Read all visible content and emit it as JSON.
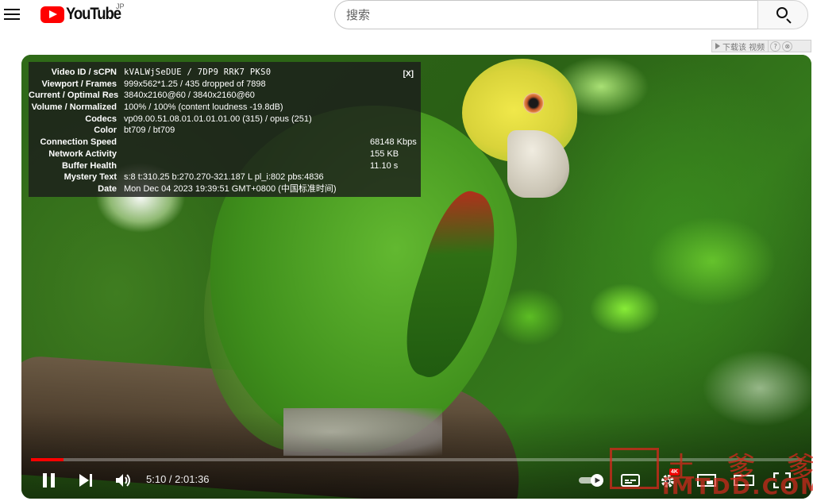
{
  "header": {
    "logo_text": "YouTube",
    "region": "JP",
    "search_placeholder": "搜索"
  },
  "download_bar": {
    "label": "下载该 视频",
    "help": "?",
    "close": "⊗"
  },
  "stats": {
    "close_label": "[X]",
    "rows": [
      {
        "label": "Video ID / sCPN",
        "value": "kVALWjSeDUE / 7DP9 RRK7 PKS0"
      },
      {
        "label": "Viewport / Frames",
        "value": "999x562*1.25 / 435 dropped of 7898"
      },
      {
        "label": "Current / Optimal Res",
        "value": "3840x2160@60 / 3840x2160@60"
      },
      {
        "label": "Volume / Normalized",
        "value": "100% / 100% (content loudness -19.8dB)"
      },
      {
        "label": "Codecs",
        "value": "vp09.00.51.08.01.01.01.01.00 (315) / opus (251)"
      },
      {
        "label": "Color",
        "value": "bt709 / bt709"
      },
      {
        "label": "Connection Speed",
        "value": "68148 Kbps"
      },
      {
        "label": "Network Activity",
        "value": "155 KB"
      },
      {
        "label": "Buffer Health",
        "value": "11.10 s"
      },
      {
        "label": "Mystery Text",
        "value": "s:8 t:310.25 b:270.270-321.187 L pl_i:802 pbs:4836"
      },
      {
        "label": "Date",
        "value": "Mon Dec 04 2023 19:39:51 GMT+0800 (中国标准时间)"
      }
    ]
  },
  "player": {
    "time_current": "5:10",
    "time_separator": " / ",
    "time_total": "2:01:36",
    "progress_fraction": 0.042,
    "settings_badge": "4K",
    "accent_color": "#ff0000"
  },
  "watermark": {
    "text": "土 爹 爹",
    "sub": "iMTDD.COM"
  }
}
